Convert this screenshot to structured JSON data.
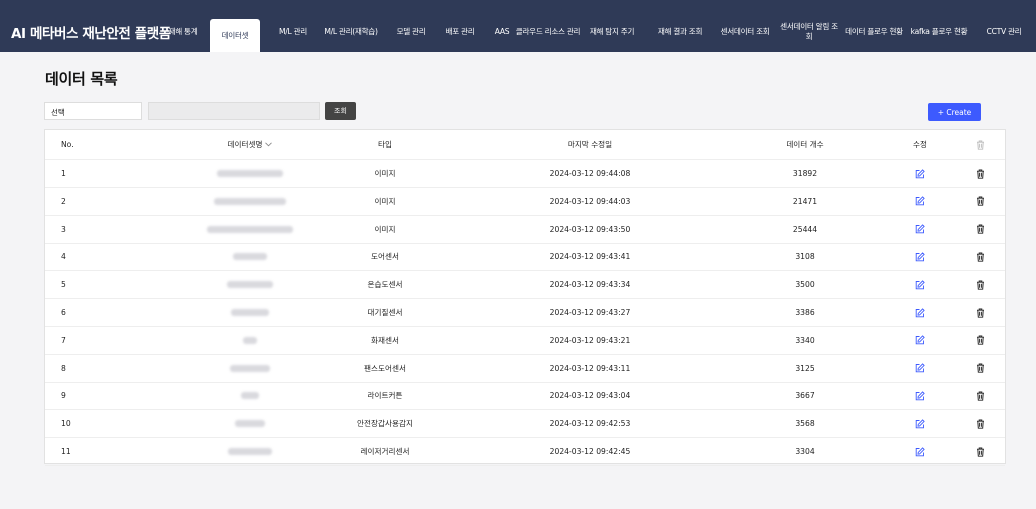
{
  "app": {
    "title": "AI 메타버스 재난안전 플랫폼"
  },
  "nav": [
    {
      "label": "재해 통계",
      "active": false
    },
    {
      "label": "데이터셋",
      "active": true
    },
    {
      "label": "M/L 관리",
      "active": false
    },
    {
      "label": "M/L 관리(재학습)",
      "active": false
    },
    {
      "label": "모델 관리",
      "active": false
    },
    {
      "label": "배포 관리",
      "active": false
    },
    {
      "label": "AAS",
      "active": false
    },
    {
      "label": "클라우드 리소스 관리",
      "active": false
    },
    {
      "label": "재해 탐지 주기",
      "active": false
    },
    {
      "label": "재해 결과 조회",
      "active": false
    },
    {
      "label": "센서데이터 조회",
      "active": false
    },
    {
      "label": "센서데이터 알림 조회",
      "active": false
    },
    {
      "label": "데이터 플로우 현황",
      "active": false
    },
    {
      "label": "kafka 플로우 현황",
      "active": false
    },
    {
      "label": "CCTV 관리",
      "active": false
    }
  ],
  "page": {
    "title": "데이터 목록"
  },
  "filter": {
    "select_value": "선택",
    "search_value": "",
    "search_button": "조회",
    "create_button": "+ Create"
  },
  "table": {
    "headers": {
      "no": "No.",
      "name": "데이터셋명",
      "type": "타입",
      "modified": "마지막 수정일",
      "count": "데이터 개수",
      "edit": "수정"
    },
    "rows": [
      {
        "no": "1",
        "type": "이미지",
        "modified": "2024-03-12 09:44:08",
        "count": "31892"
      },
      {
        "no": "2",
        "type": "이미지",
        "modified": "2024-03-12 09:44:03",
        "count": "21471"
      },
      {
        "no": "3",
        "type": "이미지",
        "modified": "2024-03-12 09:43:50",
        "count": "25444"
      },
      {
        "no": "4",
        "type": "도어센서",
        "modified": "2024-03-12 09:43:41",
        "count": "3108"
      },
      {
        "no": "5",
        "type": "온습도센서",
        "modified": "2024-03-12 09:43:34",
        "count": "3500"
      },
      {
        "no": "6",
        "type": "대기질센서",
        "modified": "2024-03-12 09:43:27",
        "count": "3386"
      },
      {
        "no": "7",
        "type": "화재센서",
        "modified": "2024-03-12 09:43:21",
        "count": "3340"
      },
      {
        "no": "8",
        "type": "팬스도어센서",
        "modified": "2024-03-12 09:43:11",
        "count": "3125"
      },
      {
        "no": "9",
        "type": "라이트커튼",
        "modified": "2024-03-12 09:43:04",
        "count": "3667"
      },
      {
        "no": "10",
        "type": "안전장갑사용감지",
        "modified": "2024-03-12 09:42:53",
        "count": "3568"
      },
      {
        "no": "11",
        "type": "레이저거리센서",
        "modified": "2024-03-12 09:42:45",
        "count": "3304"
      }
    ]
  },
  "colors": {
    "navbar": "#2f3a57",
    "primary": "#3d5afe",
    "search_button": "#444444",
    "edit_icon": "#3d5afe"
  }
}
